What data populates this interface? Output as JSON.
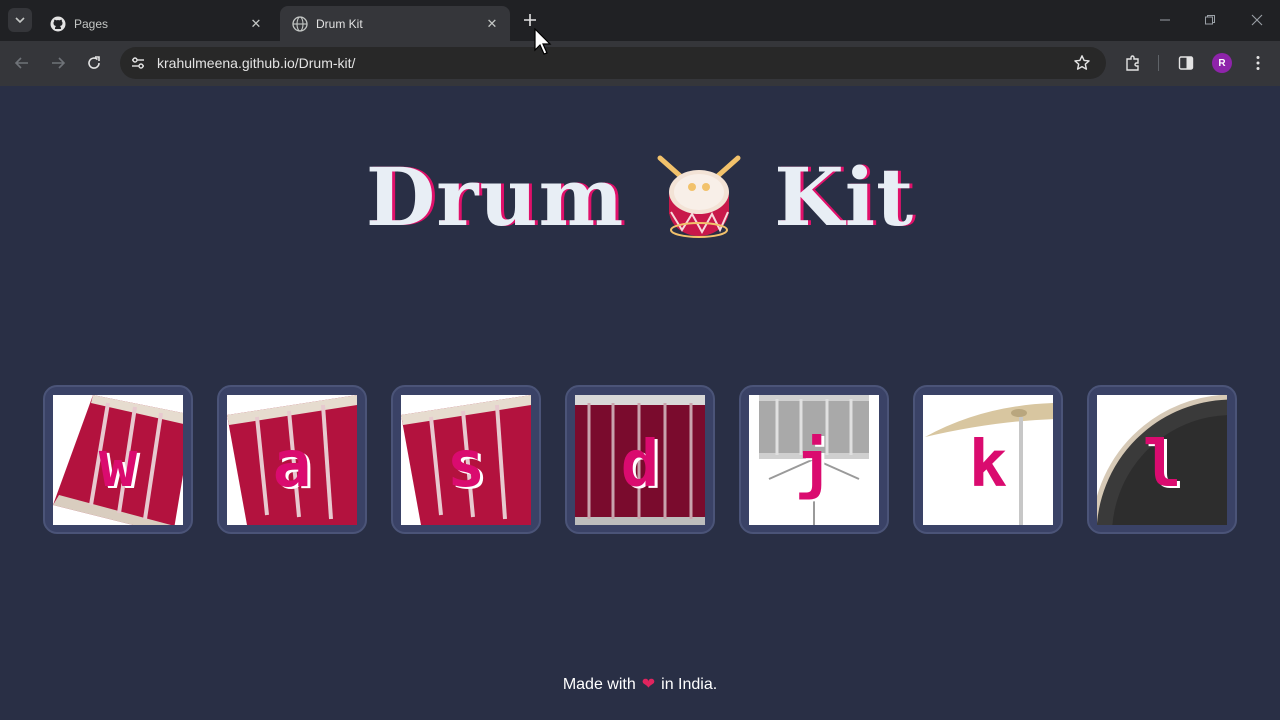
{
  "browser": {
    "tabs": [
      {
        "title": "Pages",
        "active": false,
        "icon": "github-icon"
      },
      {
        "title": "Drum Kit",
        "active": true,
        "icon": "globe-icon"
      }
    ],
    "url": "krahulmeena.github.io/Drum-kit/",
    "profile_initial": "R"
  },
  "page": {
    "title_left": "Drum",
    "title_right": "Kit",
    "title_emoji": "drum-icon",
    "accent_color": "#da0b6f",
    "background_color": "#292f45",
    "pads": [
      {
        "key": "w",
        "instrument": "tom-drum"
      },
      {
        "key": "a",
        "instrument": "tom-drum"
      },
      {
        "key": "s",
        "instrument": "tom-drum"
      },
      {
        "key": "d",
        "instrument": "bass-drum"
      },
      {
        "key": "j",
        "instrument": "snare-drum"
      },
      {
        "key": "k",
        "instrument": "crash-cymbal"
      },
      {
        "key": "l",
        "instrument": "kick-drum"
      }
    ],
    "footer": {
      "before": "Made with",
      "heart": "❤",
      "after": "in India."
    }
  }
}
